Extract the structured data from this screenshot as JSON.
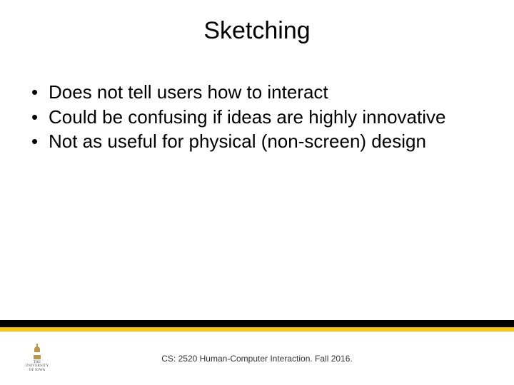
{
  "title": "Sketching",
  "bullets": [
    "Does not tell users how to interact",
    "Could be confusing if ideas are highly innovative",
    "Not as useful for physical (non-screen) design"
  ],
  "footer": "CS: 2520 Human-Computer Interaction. Fall 2016.",
  "logo": {
    "line1": "THE",
    "line2": "UNIVERSITY",
    "line3": "OF IOWA"
  }
}
